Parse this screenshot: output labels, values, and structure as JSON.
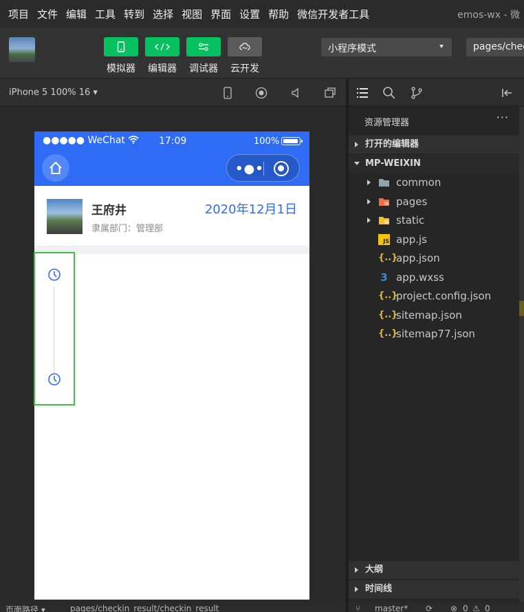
{
  "menu": {
    "items": [
      "项目",
      "文件",
      "编辑",
      "工具",
      "转到",
      "选择",
      "视图",
      "界面",
      "设置",
      "帮助",
      "微信开发者工具"
    ],
    "window_title": "emos-wx - 微"
  },
  "toolbar": {
    "buttons": [
      {
        "label": "模拟器",
        "icon": "phone-icon"
      },
      {
        "label": "编辑器",
        "icon": "code-icon"
      },
      {
        "label": "调试器",
        "icon": "debug-icon"
      },
      {
        "label": "云开发",
        "icon": "cloud-icon"
      }
    ],
    "mode_select": "小程序模式",
    "page_select": "pages/checkin_result/checkin_result"
  },
  "simulator": {
    "device_label": "iPhone 5 100% 16 ▾"
  },
  "phone": {
    "status": {
      "carrier": "●●●●● WeChat",
      "time": "17:09",
      "battery": "100%"
    },
    "user": {
      "name": "王府井",
      "dept": "隶属部门：管理部",
      "date": "2020年12月1日"
    }
  },
  "explorer": {
    "title": "资源管理器",
    "more": "···",
    "open_editors": "打开的编辑器",
    "project": "MP-WEIXIN",
    "files": [
      {
        "name": "common",
        "type": "folder",
        "color": "#90a4ae"
      },
      {
        "name": "pages",
        "type": "folder",
        "color": "#e8704b"
      },
      {
        "name": "static",
        "type": "folder",
        "color": "#f2c12e"
      },
      {
        "name": "app.js",
        "type": "js"
      },
      {
        "name": "app.json",
        "type": "json"
      },
      {
        "name": "app.wxss",
        "type": "css"
      },
      {
        "name": "project.config.json",
        "type": "json"
      },
      {
        "name": "sitemap.json",
        "type": "json"
      },
      {
        "name": "sitemap77.json",
        "type": "json"
      }
    ],
    "outline": "大纲",
    "timeline": "时间线"
  },
  "statusbar": {
    "page_path_label": "页面路径 ▾",
    "page_path": "pages/checkin_result/checkin_result",
    "branch": "master*",
    "errors": "0",
    "warnings": "0"
  },
  "colors": {
    "accent_green": "#07c160",
    "phone_blue": "#2e6cf5",
    "highlight_border": "#3bc43b"
  }
}
